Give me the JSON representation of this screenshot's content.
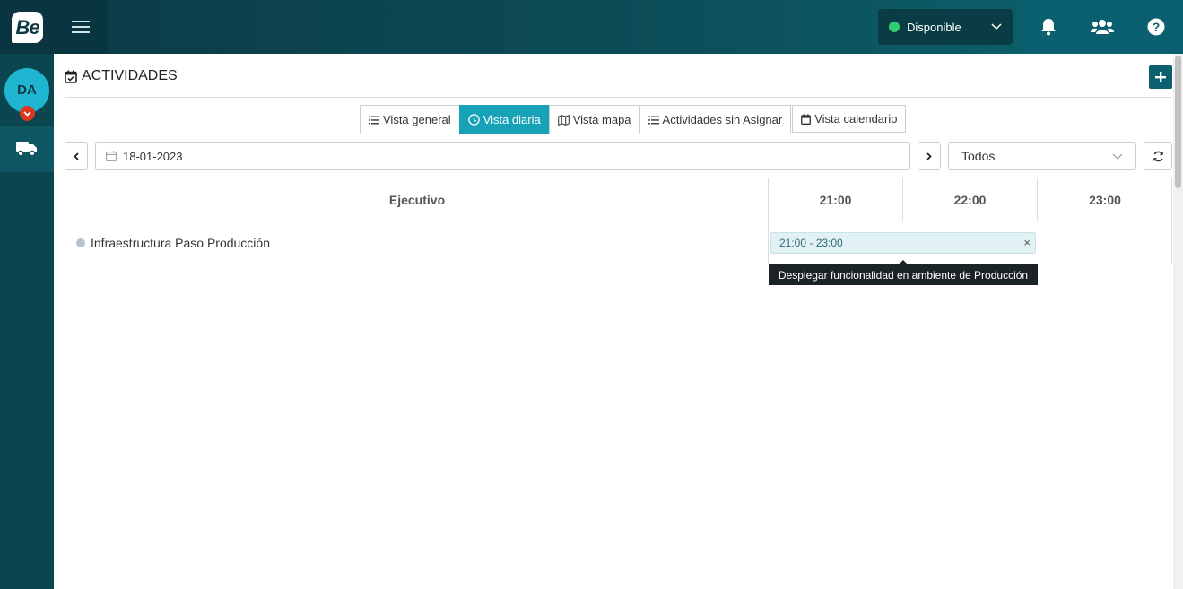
{
  "topbar": {
    "logo_text": "Be",
    "menu_icon": "hamburger-icon",
    "status": {
      "label": "Disponible",
      "dot_color": "#2ecc71",
      "chevron": "chevron-down-icon"
    },
    "icons": [
      "bell-icon",
      "users-icon",
      "help-icon"
    ]
  },
  "sidebar": {
    "avatar_initials": "DA",
    "avatar_badge_icon": "chevron-down-icon",
    "items": [
      {
        "icon": "truck-icon"
      }
    ]
  },
  "page": {
    "title": "ACTIVIDADES",
    "title_icon": "calendar-check-icon",
    "add_icon": "plus-icon"
  },
  "tabs": [
    {
      "label": "Vista general",
      "icon": "list-icon",
      "active": false
    },
    {
      "label": "Vista diaria",
      "icon": "clock-icon",
      "active": true
    },
    {
      "label": "Vista mapa",
      "icon": "map-icon",
      "active": false
    },
    {
      "label": "Actividades sin Asignar",
      "icon": "list-icon",
      "active": false
    },
    {
      "label": "Vista calendario",
      "icon": "calendar-icon",
      "active": false
    }
  ],
  "filters": {
    "date": "18-01-2023",
    "select_value": "Todos"
  },
  "schedule": {
    "column_header": "Ejecutivo",
    "hours": [
      "21:00",
      "22:00",
      "23:00"
    ],
    "rows": [
      {
        "name": "Infraestructura Paso Producción"
      }
    ],
    "event": {
      "time_label": "21:00 - 23:00",
      "close_label": "×",
      "tooltip": "Desplegar funcionalidad en ambiente de Producción"
    }
  },
  "colors": {
    "accent": "#17a2b8",
    "topbar": "#0b3a44",
    "sidebar": "#0a4550",
    "badge": "#d9381e"
  }
}
